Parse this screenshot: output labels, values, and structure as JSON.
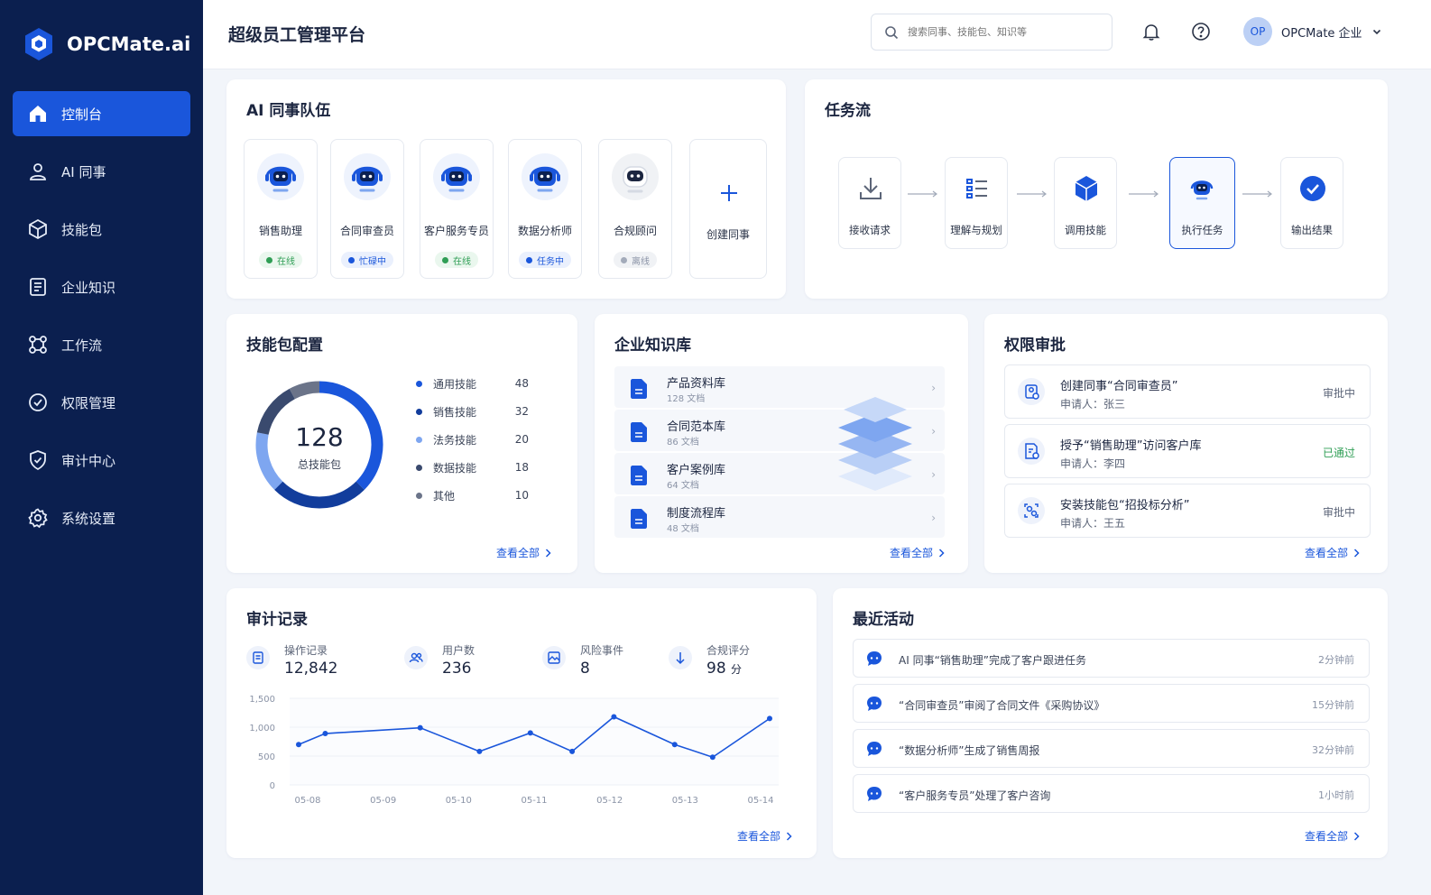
{
  "app": {
    "name": "OPCMate.ai"
  },
  "sidebar": {
    "items": [
      {
        "label": "控制台",
        "icon": "home-icon",
        "active": true
      },
      {
        "label": "AI 同事",
        "icon": "user-icon"
      },
      {
        "label": "技能包",
        "icon": "cube-icon"
      },
      {
        "label": "企业知识",
        "icon": "document-icon"
      },
      {
        "label": "工作流",
        "icon": "workflow-icon"
      },
      {
        "label": "权限管理",
        "icon": "check-circle-icon"
      },
      {
        "label": "审计中心",
        "icon": "shield-check-icon"
      },
      {
        "label": "系统设置",
        "icon": "gear-icon"
      }
    ]
  },
  "header": {
    "title": "超级员工管理平台",
    "search_placeholder": "搜索同事、技能包、知识等",
    "user": {
      "initials": "OP",
      "name": "OPCMate 企业"
    }
  },
  "colors": {
    "primary": "#1a56db",
    "sidebar": "#0b1f4f",
    "online": "#2f9e55",
    "approved": "#2f9e55"
  },
  "team": {
    "title": "AI 同事队伍",
    "agents": [
      {
        "name": "销售助理",
        "status": "在线",
        "status_type": "online"
      },
      {
        "name": "合同审查员",
        "status": "忙碌中",
        "status_type": "busy"
      },
      {
        "name": "客户服务专员",
        "status": "在线",
        "status_type": "online"
      },
      {
        "name": "数据分析师",
        "status": "任务中",
        "status_type": "busy"
      },
      {
        "name": "合规顾问",
        "status": "离线",
        "status_type": "offline"
      }
    ],
    "create_label": "创建同事"
  },
  "flow": {
    "title": "任务流",
    "steps": [
      {
        "label": "接收请求",
        "icon": "download-icon"
      },
      {
        "label": "理解与规划",
        "icon": "list-icon"
      },
      {
        "label": "调用技能",
        "icon": "cube-icon"
      },
      {
        "label": "执行任务",
        "icon": "robot-icon",
        "current": true
      },
      {
        "label": "输出结果",
        "icon": "check-icon"
      }
    ]
  },
  "skills": {
    "title": "技能包配置",
    "total": "128",
    "total_label": "总技能包",
    "items": [
      {
        "label": "通用技能",
        "value": 48,
        "color": "#1a56db"
      },
      {
        "label": "销售技能",
        "value": 32,
        "color": "#123d9c"
      },
      {
        "label": "法务技能",
        "value": 20,
        "color": "#7ea6f0"
      },
      {
        "label": "数据技能",
        "value": 18,
        "color": "#3a4a6e"
      },
      {
        "label": "其他",
        "value": 10,
        "color": "#6b7489"
      }
    ],
    "view_all": "查看全部"
  },
  "knowledge": {
    "title": "企业知识库",
    "items": [
      {
        "name": "产品资料库",
        "count": "128 文档"
      },
      {
        "name": "合同范本库",
        "count": "86 文档"
      },
      {
        "name": "客户案例库",
        "count": "64 文档"
      },
      {
        "name": "制度流程库",
        "count": "48 文档"
      }
    ],
    "view_all": "查看全部"
  },
  "approval": {
    "title": "权限审批",
    "items": [
      {
        "title": "创建同事“合同审查员”",
        "applicant": "申请人：张三",
        "status": "审批中",
        "status_type": "pending"
      },
      {
        "title": "授予“销售助理”访问客户库",
        "applicant": "申请人：李四",
        "status": "已通过",
        "status_type": "approved"
      },
      {
        "title": "安装技能包“招投标分析”",
        "applicant": "申请人：王五",
        "status": "审批中",
        "status_type": "pending"
      }
    ],
    "view_all": "查看全部"
  },
  "audit": {
    "title": "审计记录",
    "stats": [
      {
        "label": "操作记录",
        "value": "12,842",
        "icon": "list-icon"
      },
      {
        "label": "用户数",
        "value": "236",
        "icon": "users-icon"
      },
      {
        "label": "风险事件",
        "value": "8",
        "icon": "image-alert-icon"
      },
      {
        "label": "合规评分",
        "value": "98",
        "unit": "分",
        "icon": "arrow-down-icon"
      }
    ],
    "view_all": "查看全部"
  },
  "chart_data": {
    "type": "line",
    "x": [
      "05-08",
      "05-09",
      "05-10",
      "05-11",
      "05-12",
      "05-13",
      "05-14"
    ],
    "x_values": [
      0,
      0.3,
      1.57,
      2.2,
      2.8,
      3.37,
      3.95,
      4.52,
      5.18,
      5.63,
      6.2
    ],
    "y_values": [
      700,
      890,
      990,
      580,
      900,
      580,
      1180,
      700,
      480,
      1150
    ],
    "points": [
      {
        "x": 0.0,
        "y": 700
      },
      {
        "x": 0.35,
        "y": 890
      },
      {
        "x": 1.6,
        "y": 990
      },
      {
        "x": 2.38,
        "y": 580
      },
      {
        "x": 3.05,
        "y": 900
      },
      {
        "x": 3.6,
        "y": 580
      },
      {
        "x": 4.15,
        "y": 1180
      },
      {
        "x": 4.95,
        "y": 700
      },
      {
        "x": 5.45,
        "y": 480
      },
      {
        "x": 6.2,
        "y": 1150
      }
    ],
    "yticks": [
      "0",
      "500",
      "1,000",
      "1,500"
    ],
    "ylim": [
      0,
      1500
    ],
    "grid": true,
    "color": "#1a56db"
  },
  "activity": {
    "title": "最近活动",
    "items": [
      {
        "text": "AI 同事“销售助理”完成了客户跟进任务",
        "time": "2分钟前"
      },
      {
        "text": "“合同审查员”审阅了合同文件《采购协议》",
        "time": "15分钟前"
      },
      {
        "text": "“数据分析师”生成了销售周报",
        "time": "32分钟前"
      },
      {
        "text": "“客户服务专员”处理了客户咨询",
        "time": "1小时前"
      }
    ],
    "view_all": "查看全部"
  }
}
